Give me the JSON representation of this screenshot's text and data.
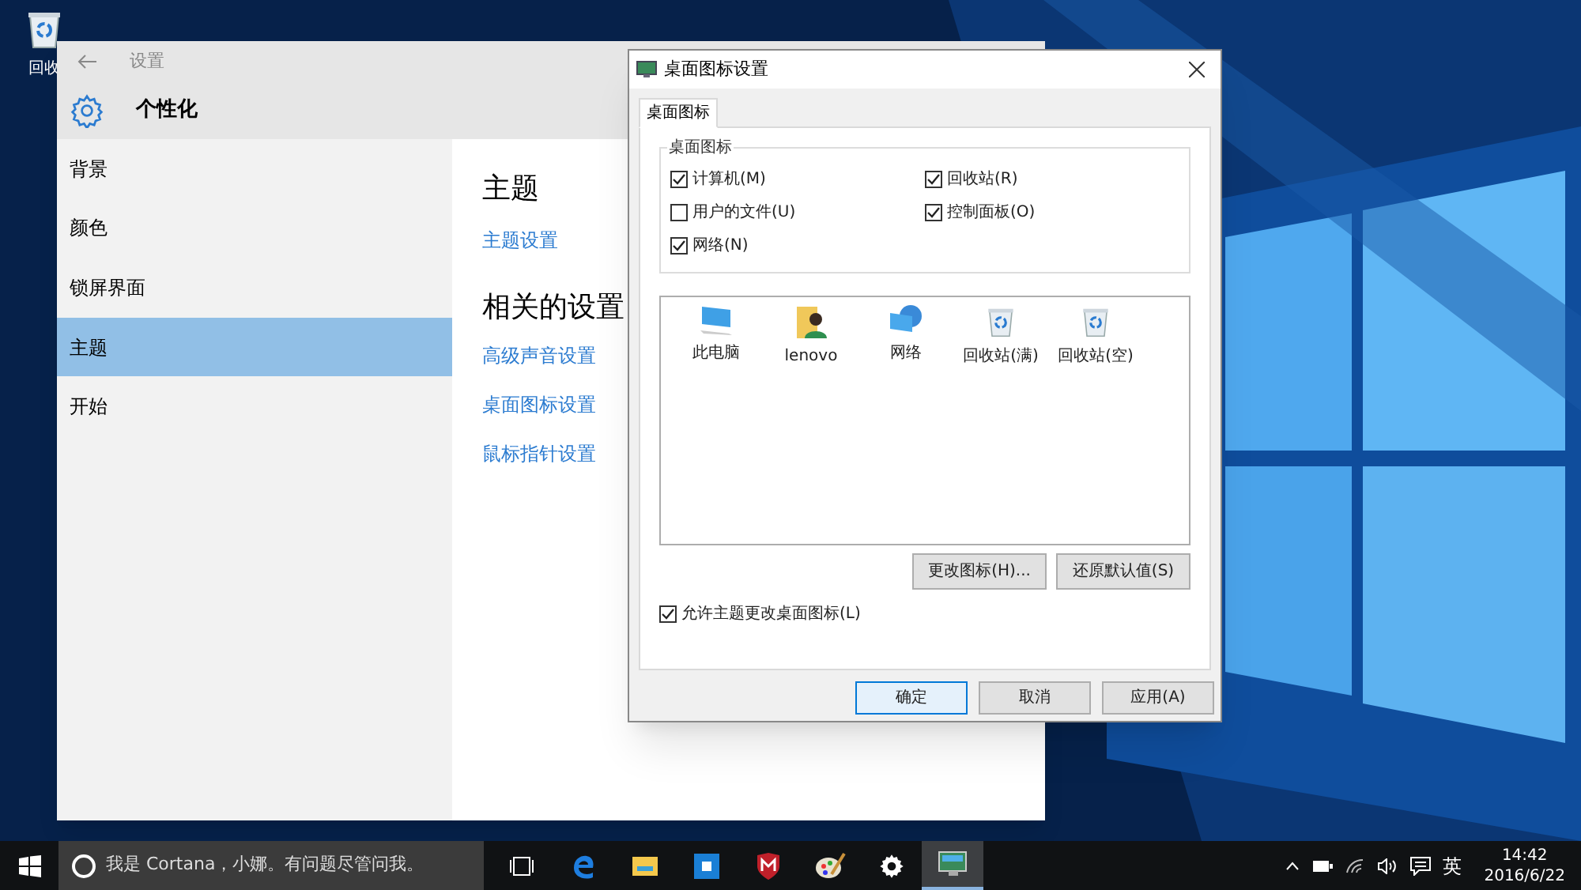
{
  "desktop": {
    "icons": [
      {
        "label": "回收"
      }
    ]
  },
  "settings_window": {
    "title": "设置",
    "header": "个性化",
    "sidebar": [
      {
        "label": "背景",
        "selected": false
      },
      {
        "label": "颜色",
        "selected": false
      },
      {
        "label": "锁屏界面",
        "selected": false
      },
      {
        "label": "主题",
        "selected": true
      },
      {
        "label": "开始",
        "selected": false
      }
    ],
    "content": {
      "heading": "主题",
      "link": "主题设置",
      "related_heading": "相关的设置",
      "related_links": [
        "高级声音设置",
        "桌面图标设置",
        "鼠标指针设置"
      ]
    }
  },
  "dialog": {
    "title": "桌面图标设置",
    "tabs": [
      {
        "label": "桌面图标",
        "selected": true
      }
    ],
    "group_title": "桌面图标",
    "checkboxes": [
      {
        "label": "计算机(M)",
        "checked": true
      },
      {
        "label": "回收站(R)",
        "checked": true
      },
      {
        "label": "用户的文件(U)",
        "checked": false
      },
      {
        "label": "控制面板(O)",
        "checked": true
      },
      {
        "label": "网络(N)",
        "checked": true
      }
    ],
    "icons": [
      {
        "label": "此电脑",
        "kind": "computer"
      },
      {
        "label": "lenovo",
        "kind": "user"
      },
      {
        "label": "网络",
        "kind": "network"
      },
      {
        "label": "回收站(满)",
        "kind": "recycle"
      },
      {
        "label": "回收站(空)",
        "kind": "recycle"
      }
    ],
    "buttons": [
      "更改图标(H)...",
      "还原默认值(S)"
    ],
    "allow_theme": {
      "label": "允许主题更改桌面图标(L)",
      "checked": true
    },
    "footer_buttons": [
      {
        "label": "确定",
        "default": true
      },
      {
        "label": "取消",
        "default": false
      },
      {
        "label": "应用(A)",
        "default": false
      }
    ]
  },
  "taskbar": {
    "search_placeholder": "我是 Cortana，小娜。有问题尽管问我。",
    "apps": [
      {
        "kind": "task-view",
        "active": false
      },
      {
        "kind": "edge",
        "active": false
      },
      {
        "kind": "explorer",
        "active": false
      },
      {
        "kind": "store",
        "active": false
      },
      {
        "kind": "shield",
        "active": false
      },
      {
        "kind": "paint",
        "active": false
      },
      {
        "kind": "settings",
        "active": false
      },
      {
        "kind": "display",
        "active": true
      }
    ],
    "ime": "英",
    "time": "14:42",
    "date": "2016/6/22"
  }
}
